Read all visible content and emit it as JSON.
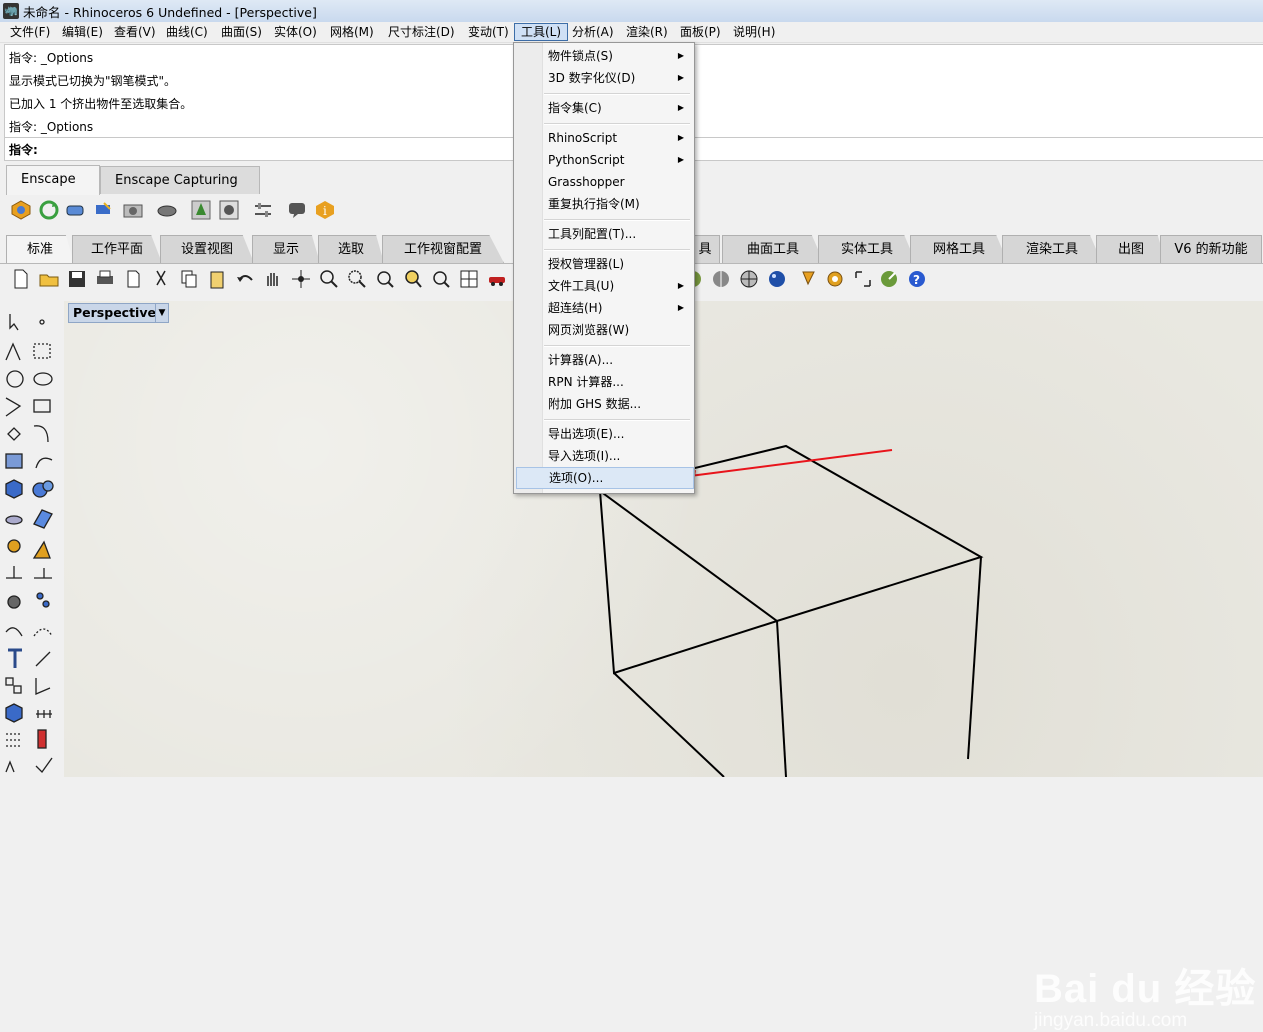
{
  "window": {
    "title": "未命名 - Rhinoceros 6 Undefined - [Perspective]"
  },
  "menubar": {
    "items": [
      "文件(F)",
      "编辑(E)",
      "查看(V)",
      "曲线(C)",
      "曲面(S)",
      "实体(O)",
      "网格(M)",
      "尺寸标注(D)",
      "变动(T)",
      "工具(L)",
      "分析(A)",
      "渲染(R)",
      "面板(P)",
      "说明(H)"
    ],
    "active": "工具(L)"
  },
  "command": {
    "history": [
      "指令: _Options",
      "显示模式已切换为\"钢笔模式\"。",
      "已加入 1 个挤出物件至选取集合。",
      "指令: _Options"
    ],
    "prompt": "指令:"
  },
  "enscape": {
    "tabs": [
      "Enscape",
      "Enscape Capturing"
    ],
    "active": "Enscape"
  },
  "rhino_tabs": [
    "标准",
    "工作平面",
    "设置视图",
    "显示",
    "选取",
    "工作视窗配置",
    "",
    "曲面工具",
    "实体工具",
    "网格工具",
    "渲染工具",
    "出图",
    "V6 的新功能"
  ],
  "rhino_tabs_partial": "具",
  "viewport": {
    "label": "Perspective",
    "dropdown_arrow": "▼"
  },
  "tools_menu": {
    "items": [
      {
        "label": "物件锁点(S)",
        "submenu": true
      },
      {
        "label": "3D 数字化仪(D)",
        "submenu": true
      },
      {
        "sep": true
      },
      {
        "label": "指令集(C)",
        "submenu": true
      },
      {
        "sep": true
      },
      {
        "label": "RhinoScript",
        "submenu": true
      },
      {
        "label": "PythonScript",
        "submenu": true
      },
      {
        "label": "Grasshopper",
        "submenu": false
      },
      {
        "label": "重复执行指令(M)",
        "submenu": false
      },
      {
        "sep": true
      },
      {
        "label": "工具列配置(T)...",
        "submenu": false
      },
      {
        "sep": true
      },
      {
        "label": "授权管理器(L)",
        "submenu": false
      },
      {
        "label": "文件工具(U)",
        "submenu": true
      },
      {
        "label": "超连结(H)",
        "submenu": true
      },
      {
        "label": "网页浏览器(W)",
        "submenu": false
      },
      {
        "sep": true
      },
      {
        "label": "计算器(A)...",
        "submenu": false
      },
      {
        "label": "RPN 计算器...",
        "submenu": false
      },
      {
        "label": "附加 GHS 数据...",
        "submenu": false
      },
      {
        "sep": true
      },
      {
        "label": "导出选项(E)...",
        "submenu": false
      },
      {
        "label": "导入选项(I)...",
        "submenu": false
      },
      {
        "label": "选项(O)...",
        "submenu": false,
        "highlighted": true
      }
    ]
  },
  "watermark": {
    "logo": "Bai du 经验",
    "url": "jingyan.baidu.com"
  },
  "colors": {
    "annotation_arrow": "#e8141b",
    "menu_highlight": "#dce8f6",
    "viewport_bg": "#e9e8e1"
  }
}
